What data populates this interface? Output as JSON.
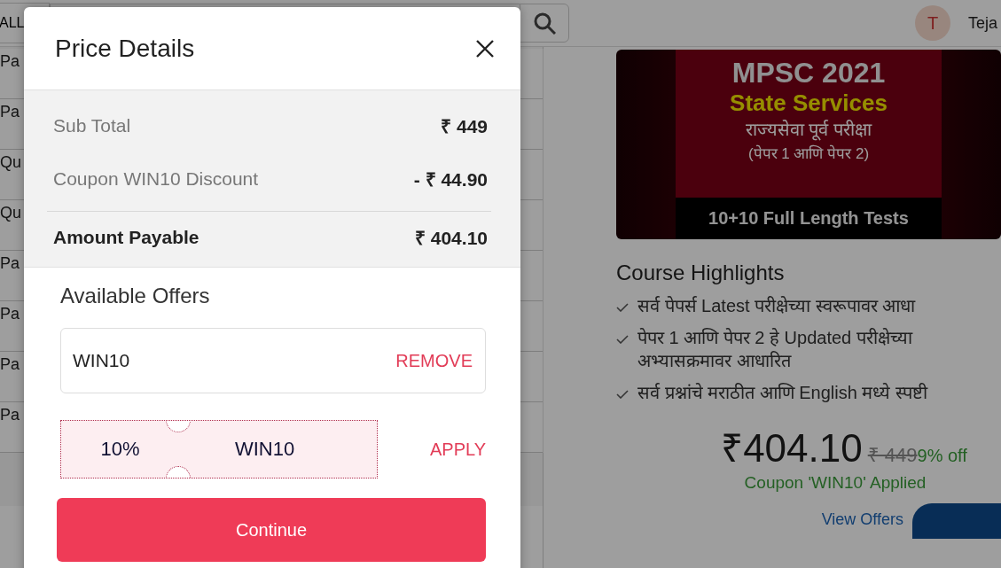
{
  "header": {
    "category": "ALL",
    "user": {
      "initial": "T",
      "name": "Teja"
    }
  },
  "list": {
    "items": [
      {
        "label": "Pa"
      },
      {
        "label": "Pa"
      },
      {
        "label": "Qu"
      },
      {
        "label": "Qu"
      },
      {
        "label": "Pa"
      },
      {
        "label": "Pa"
      },
      {
        "label": "Pa"
      },
      {
        "label": "Pa"
      }
    ]
  },
  "course": {
    "banner": {
      "title": "MPSC 2021",
      "subtitle": "State Services",
      "line_1": "राज्यसेवा पूर्व परीक्षा",
      "line_2": "(पेपर 1 आणि पेपर 2)",
      "footer": "10+10 Full Length Tests"
    },
    "highlights_title": "Course Highlights",
    "highlights": [
      "सर्व पेपर्स Latest परीक्षेच्या स्वरूपावर आधा",
      "पेपर 1 आणि पेपर 2 हे Updated परीक्षेच्या अभ्यासक्रमावर आधारित",
      "सर्व प्रश्नांचे मराठीत आणि English मध्ये स्पष्टी"
    ],
    "price": "₹404.10",
    "original_price": "₹ 449",
    "discount": "9% off",
    "coupon_note": "Coupon 'WIN10' Applied",
    "view_offers": "View Offers"
  },
  "dialog": {
    "title": "Price Details",
    "summary": [
      {
        "label": "Sub Total",
        "value": "₹ 449",
        "kind": "line"
      },
      {
        "label": "Coupon WIN10 Discount",
        "value": "- ₹ 44.90",
        "kind": "line"
      },
      {
        "label": "Amount Payable",
        "value": "₹ 404.10",
        "kind": "total"
      }
    ],
    "offers_title": "Available Offers",
    "applied_coupon": {
      "value": "WIN10",
      "action": "REMOVE"
    },
    "offers": [
      {
        "discount": "10%",
        "code": "WIN10",
        "action": "APPLY"
      }
    ],
    "continue": "Continue"
  }
}
